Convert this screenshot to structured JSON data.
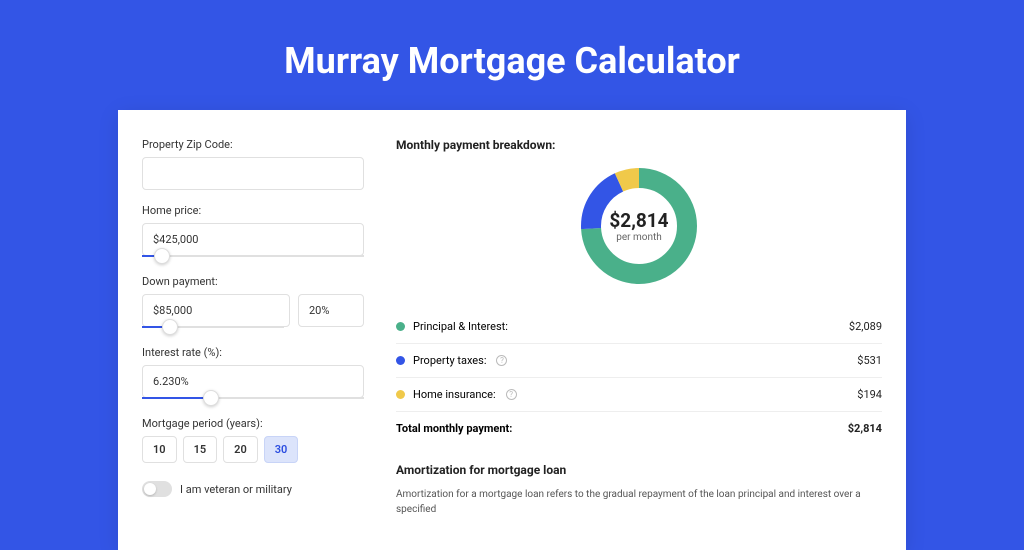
{
  "title": "Murray Mortgage Calculator",
  "form": {
    "zip": {
      "label": "Property Zip Code:",
      "value": ""
    },
    "home_price": {
      "label": "Home price:",
      "value": "$425,000",
      "slider_pct": 9
    },
    "down_payment": {
      "label": "Down payment:",
      "value": "$85,000",
      "pct_value": "20%",
      "slider_pct": 20
    },
    "interest": {
      "label": "Interest rate (%):",
      "value": "6.230%",
      "slider_pct": 31
    },
    "period": {
      "label": "Mortgage period (years):",
      "options": [
        "10",
        "15",
        "20",
        "30"
      ],
      "selected": "30"
    },
    "veteran": {
      "label": "I am veteran or military",
      "checked": false
    }
  },
  "breakdown": {
    "title": "Monthly payment breakdown:",
    "center_value": "$2,814",
    "center_sub": "per month",
    "items": [
      {
        "label": "Principal & Interest:",
        "value": "$2,089",
        "color": "#4ab08a",
        "pct": 74,
        "info": false
      },
      {
        "label": "Property taxes:",
        "value": "$531",
        "color": "#3355e6",
        "pct": 19,
        "info": true
      },
      {
        "label": "Home insurance:",
        "value": "$194",
        "color": "#f0c94a",
        "pct": 7,
        "info": true
      }
    ],
    "total": {
      "label": "Total monthly payment:",
      "value": "$2,814"
    }
  },
  "amortization": {
    "title": "Amortization for mortgage loan",
    "text": "Amortization for a mortgage loan refers to the gradual repayment of the loan principal and interest over a specified"
  },
  "chart_data": {
    "type": "pie",
    "title": "Monthly payment breakdown",
    "categories": [
      "Principal & Interest",
      "Property taxes",
      "Home insurance"
    ],
    "values": [
      2089,
      531,
      194
    ],
    "colors": [
      "#4ab08a",
      "#3355e6",
      "#f0c94a"
    ],
    "total": 2814,
    "unit": "USD/month"
  }
}
